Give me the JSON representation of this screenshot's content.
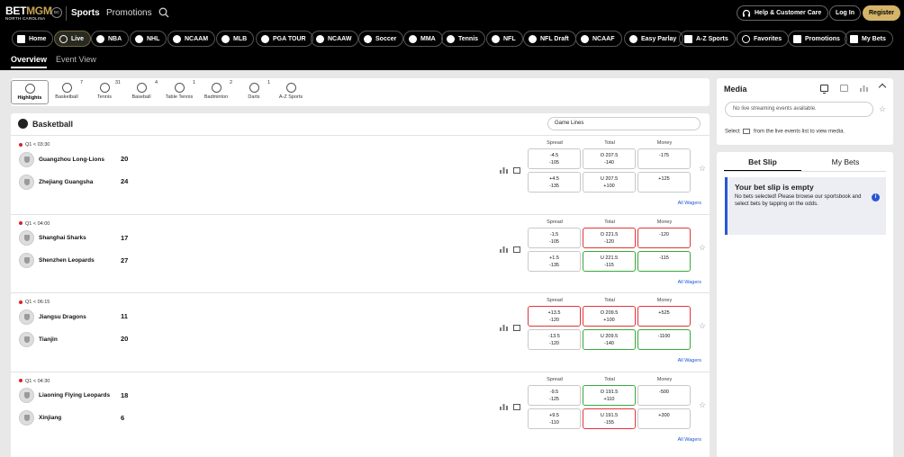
{
  "header": {
    "logo_main": "BET",
    "logo_accent": "MGM",
    "logo_sub": "NORTH CAROLINA",
    "logo_badge": "BC",
    "nav": [
      "Sports",
      "Promotions"
    ],
    "help_label": "Help & Customer Care",
    "login_label": "Log In",
    "register_label": "Register"
  },
  "sport_chips": [
    {
      "label": "Home",
      "icon": "home-icon"
    },
    {
      "label": "Live",
      "icon": "live-icon"
    },
    {
      "label": "NBA",
      "icon": "basketball-icon"
    },
    {
      "label": "NHL",
      "icon": "hockey-icon"
    },
    {
      "label": "NCAAM",
      "icon": "basketball-icon"
    },
    {
      "label": "MLB",
      "icon": "baseball-icon"
    },
    {
      "label": "PGA TOUR",
      "icon": "golf-icon"
    },
    {
      "label": "NCAAW",
      "icon": "basketball-icon"
    },
    {
      "label": "Soccer",
      "icon": "soccer-icon"
    },
    {
      "label": "MMA",
      "icon": "mma-icon"
    },
    {
      "label": "Tennis",
      "icon": "tennis-icon"
    },
    {
      "label": "NFL",
      "icon": "football-icon"
    },
    {
      "label": "NFL Draft",
      "icon": "football-icon"
    },
    {
      "label": "NCAAF",
      "icon": "football-icon"
    },
    {
      "label": "Easy Parlay",
      "icon": "parlay-icon"
    },
    {
      "label": "A-Z Sports",
      "icon": "list-icon"
    },
    {
      "label": "Favorites",
      "icon": "star-icon"
    },
    {
      "label": "Promotions",
      "icon": "gift-icon"
    },
    {
      "label": "My Bets",
      "icon": "ticket-icon"
    }
  ],
  "subnav": [
    "Overview",
    "Event View"
  ],
  "sport_icons": [
    {
      "label": "Highlights",
      "count": ""
    },
    {
      "label": "Basketball",
      "count": "7"
    },
    {
      "label": "Tennis",
      "count": "31"
    },
    {
      "label": "Baseball",
      "count": "4"
    },
    {
      "label": "Table Tennis",
      "count": "1"
    },
    {
      "label": "Badminton",
      "count": "2"
    },
    {
      "label": "Darts",
      "count": "1"
    },
    {
      "label": "A-Z Sports",
      "count": ""
    }
  ],
  "main": {
    "title": "Basketball",
    "dropdown": "Game Lines",
    "col_spread": "Spread",
    "col_total": "Total",
    "col_money": "Money",
    "all_wagers": "All Wagers"
  },
  "events": [
    {
      "time": "Q1 < 03:30",
      "teams": [
        {
          "name": "Guangzhou Long-Lions",
          "score": "20"
        },
        {
          "name": "Zhejiang Guangsha",
          "score": "24"
        }
      ],
      "odds": [
        [
          {
            "l1": "-4.5",
            "l2": "-105",
            "state": ""
          },
          {
            "l1": "O 207.5",
            "l2": "-140",
            "state": ""
          },
          {
            "l1": "-175",
            "l2": "",
            "state": ""
          }
        ],
        [
          {
            "l1": "+4.5",
            "l2": "-135",
            "state": ""
          },
          {
            "l1": "U 207.5",
            "l2": "+100",
            "state": ""
          },
          {
            "l1": "+125",
            "l2": "",
            "state": ""
          }
        ]
      ]
    },
    {
      "time": "Q1 < 04:00",
      "teams": [
        {
          "name": "Shanghai Sharks",
          "score": "17"
        },
        {
          "name": "Shenzhen Leopards",
          "score": "27"
        }
      ],
      "odds": [
        [
          {
            "l1": "-1.5",
            "l2": "-105",
            "state": ""
          },
          {
            "l1": "O 221.5",
            "l2": "-120",
            "state": "red"
          },
          {
            "l1": "-120",
            "l2": "",
            "state": "red"
          }
        ],
        [
          {
            "l1": "+1.5",
            "l2": "-135",
            "state": ""
          },
          {
            "l1": "U 221.5",
            "l2": "-115",
            "state": "green"
          },
          {
            "l1": "-115",
            "l2": "",
            "state": "green"
          }
        ]
      ]
    },
    {
      "time": "Q1 < 06:15",
      "teams": [
        {
          "name": "Jiangsu Dragons",
          "score": "11"
        },
        {
          "name": "Tianjin",
          "score": "20"
        }
      ],
      "odds": [
        [
          {
            "l1": "+13.5",
            "l2": "-120",
            "state": "red"
          },
          {
            "l1": "O 209.5",
            "l2": "+100",
            "state": "red"
          },
          {
            "l1": "+525",
            "l2": "",
            "state": "red"
          }
        ],
        [
          {
            "l1": "-13.5",
            "l2": "-120",
            "state": ""
          },
          {
            "l1": "U 209.5",
            "l2": "-140",
            "state": "green"
          },
          {
            "l1": "-1100",
            "l2": "",
            "state": "green"
          }
        ]
      ]
    },
    {
      "time": "Q1 < 04:30",
      "teams": [
        {
          "name": "Liaoning Flying Leopards",
          "score": "18"
        },
        {
          "name": "Xinjiang",
          "score": "6"
        }
      ],
      "odds": [
        [
          {
            "l1": "-9.5",
            "l2": "-125",
            "state": ""
          },
          {
            "l1": "O 191.5",
            "l2": "+110",
            "state": "green"
          },
          {
            "l1": "-500",
            "l2": "",
            "state": ""
          }
        ],
        [
          {
            "l1": "+9.5",
            "l2": "-110",
            "state": ""
          },
          {
            "l1": "U 191.5",
            "l2": "-155",
            "state": "red"
          },
          {
            "l1": "+300",
            "l2": "",
            "state": ""
          }
        ]
      ]
    }
  ],
  "media": {
    "title": "Media",
    "select_placeholder": "No live streaming events available.",
    "note_pre": "Select",
    "note_post": "from the live events list to view media."
  },
  "betslip": {
    "tabs": [
      "Bet Slip",
      "My Bets"
    ],
    "empty_title": "Your bet slip is empty",
    "empty_text": "No bets selected! Please browse our sportsbook and select bets by tapping on the odds."
  },
  "colors": {
    "accent": "#d4b46a",
    "link": "#1a55d6",
    "red": "#e0363a",
    "green": "#39a83a",
    "info": "#2a56d6"
  }
}
